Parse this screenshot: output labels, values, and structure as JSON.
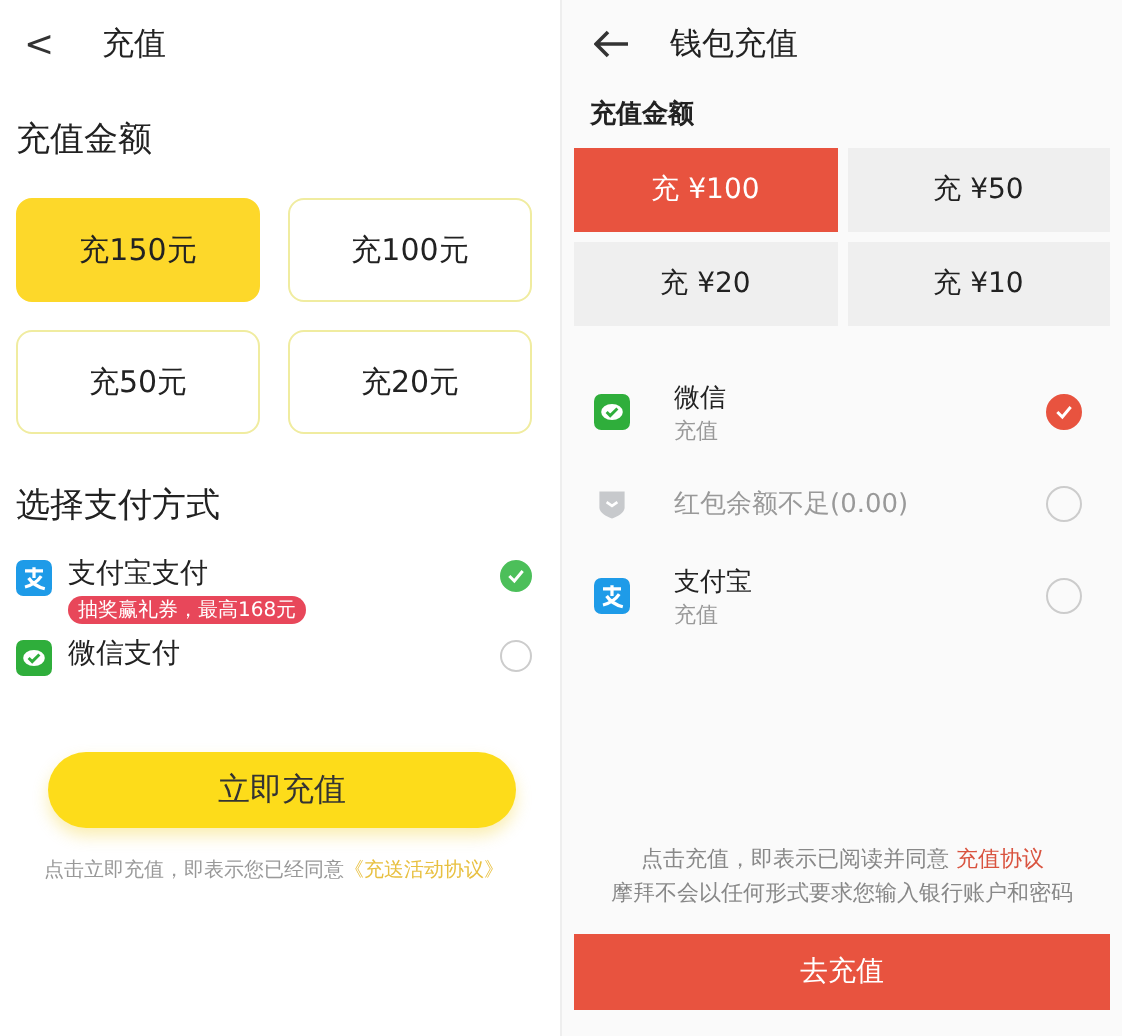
{
  "left": {
    "back": "<",
    "title": "充值",
    "amount_title": "充值金额",
    "amounts": [
      {
        "label": "充150元",
        "selected": true
      },
      {
        "label": "充100元",
        "selected": false
      },
      {
        "label": "充50元",
        "selected": false
      },
      {
        "label": "充20元",
        "selected": false
      }
    ],
    "pay_title": "选择支付方式",
    "methods": [
      {
        "kind": "alipay",
        "name": "支付宝支付",
        "badge": "抽奖赢礼券，最高168元",
        "selected": true
      },
      {
        "kind": "wechat",
        "name": "微信支付",
        "selected": false
      }
    ],
    "submit": "立即充值",
    "note": "点击立即充值，即表示您已经同意",
    "link": "《充送活动协议》"
  },
  "right": {
    "title": "钱包充值",
    "amount_title": "充值金额",
    "amounts": [
      {
        "label": "充 ¥100",
        "selected": true
      },
      {
        "label": "充 ¥50",
        "selected": false
      },
      {
        "label": "充 ¥20",
        "selected": false
      },
      {
        "label": "充 ¥10",
        "selected": false
      }
    ],
    "methods": [
      {
        "kind": "wechat",
        "name": "微信",
        "sub": "充值",
        "selected": true,
        "disabled": false
      },
      {
        "kind": "redpacket",
        "name": "红包余额不足(0.00)",
        "selected": false,
        "disabled": true
      },
      {
        "kind": "alipay",
        "name": "支付宝",
        "sub": "充值",
        "selected": false,
        "disabled": false
      }
    ],
    "note": "点击充值，即表示已阅读并同意",
    "link": "充值协议",
    "note2": "摩拜不会以任何形式要求您输入银行账户和密码",
    "submit": "去充值"
  }
}
